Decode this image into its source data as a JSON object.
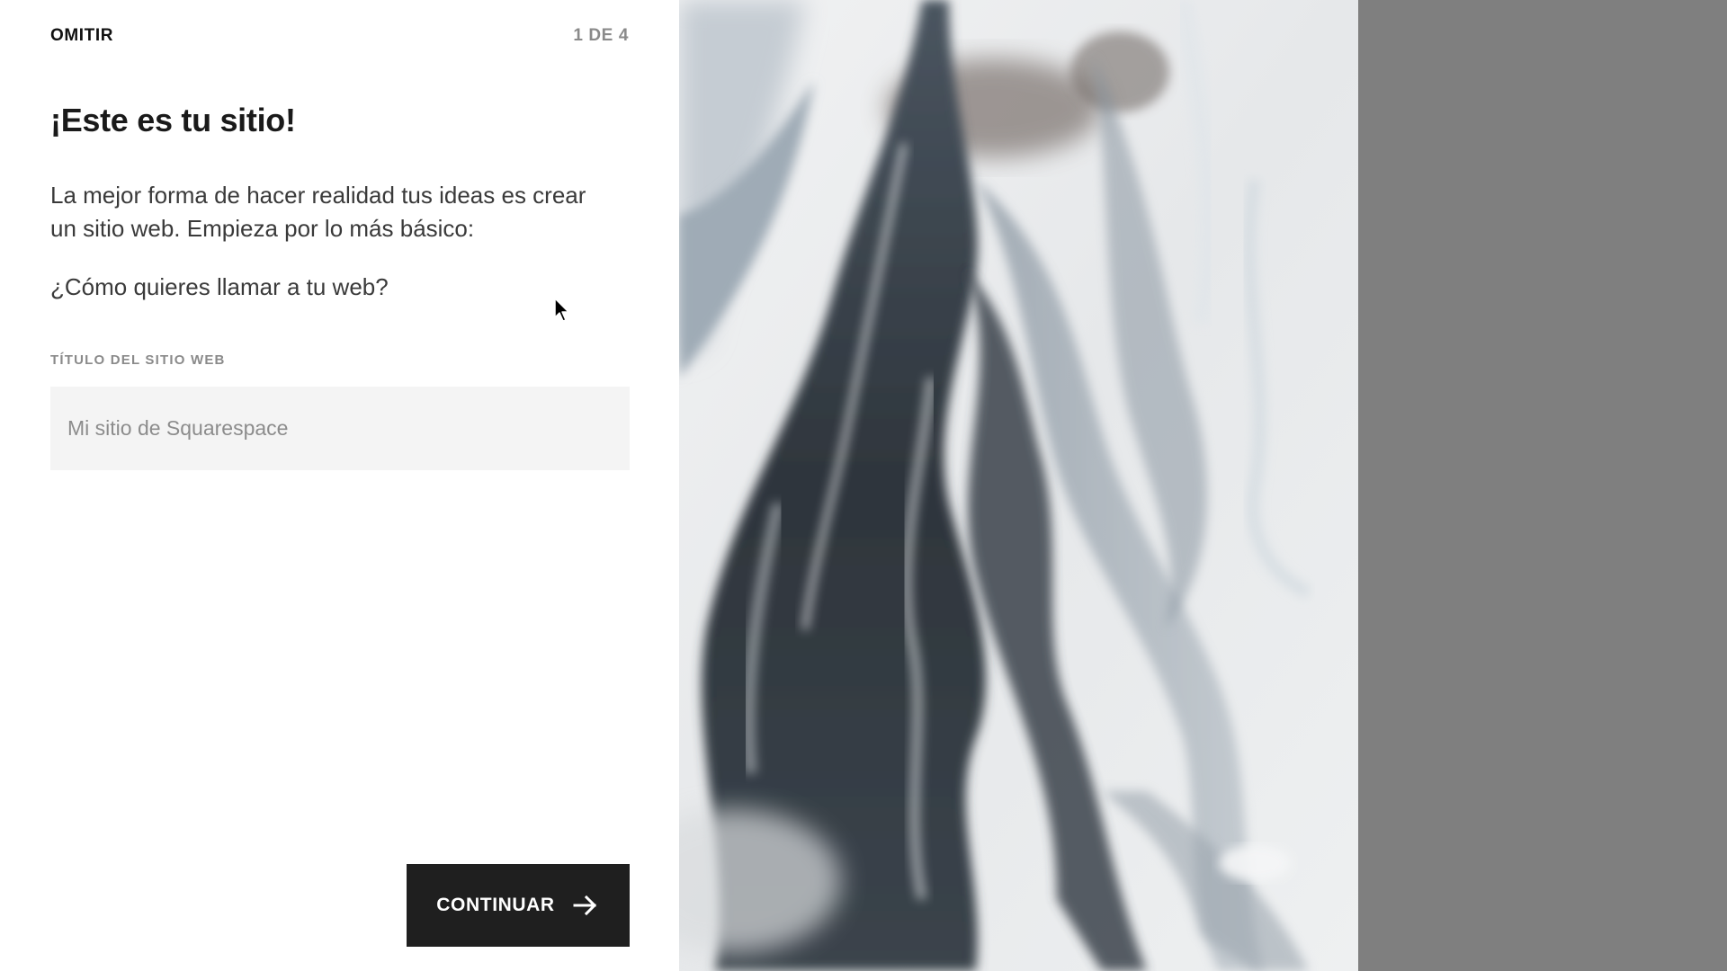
{
  "header": {
    "skip_label": "OMITIR",
    "step_label": "1 DE 4"
  },
  "main": {
    "headline": "¡Este es tu sitio!",
    "intro": "La mejor forma de hacer realidad tus ideas es crear un sitio web. Empieza por lo más básico:",
    "question": "¿Cómo quieres llamar a tu web?",
    "field_label": "TÍTULO DEL SITIO WEB",
    "field_placeholder": "Mi sitio de Squarespace",
    "field_value": ""
  },
  "footer": {
    "continue_label": "CONTINUAR",
    "continue_icon": "arrow-right-icon"
  },
  "image_panel": {
    "subject": "marble-ink-texture"
  },
  "colors": {
    "page_background": "#7f7f7f",
    "panel_background": "#ffffff",
    "button_background": "#1f1f1f",
    "input_background": "#f4f4f4",
    "muted_text": "#8a8a8a",
    "body_text": "#3a3a3a"
  }
}
